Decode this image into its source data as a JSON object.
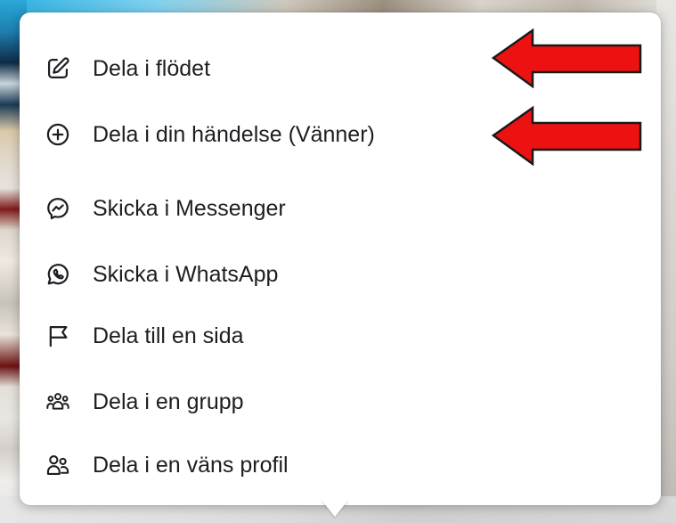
{
  "share_menu": {
    "items": [
      {
        "label": "Dela i flödet",
        "icon": "edit-icon"
      },
      {
        "label": "Dela i din händelse (Vänner)",
        "icon": "add-circle-icon"
      },
      {
        "label": "Skicka i Messenger",
        "icon": "messenger-icon"
      },
      {
        "label": "Skicka i WhatsApp",
        "icon": "whatsapp-icon"
      },
      {
        "label": "Dela till en sida",
        "icon": "flag-icon"
      },
      {
        "label": "Dela i en grupp",
        "icon": "group-icon"
      },
      {
        "label": "Dela i en väns profil",
        "icon": "friends-icon"
      }
    ]
  },
  "annotations": {
    "arrow_color": "#ee1111",
    "arrows": [
      {
        "points_to": "Dela i flödet"
      },
      {
        "points_to": "Dela i din händelse (Vänner)"
      }
    ]
  },
  "colors": {
    "menu_background": "#ffffff",
    "text": "#1c1e21",
    "icon_stroke": "#1c1e21"
  }
}
